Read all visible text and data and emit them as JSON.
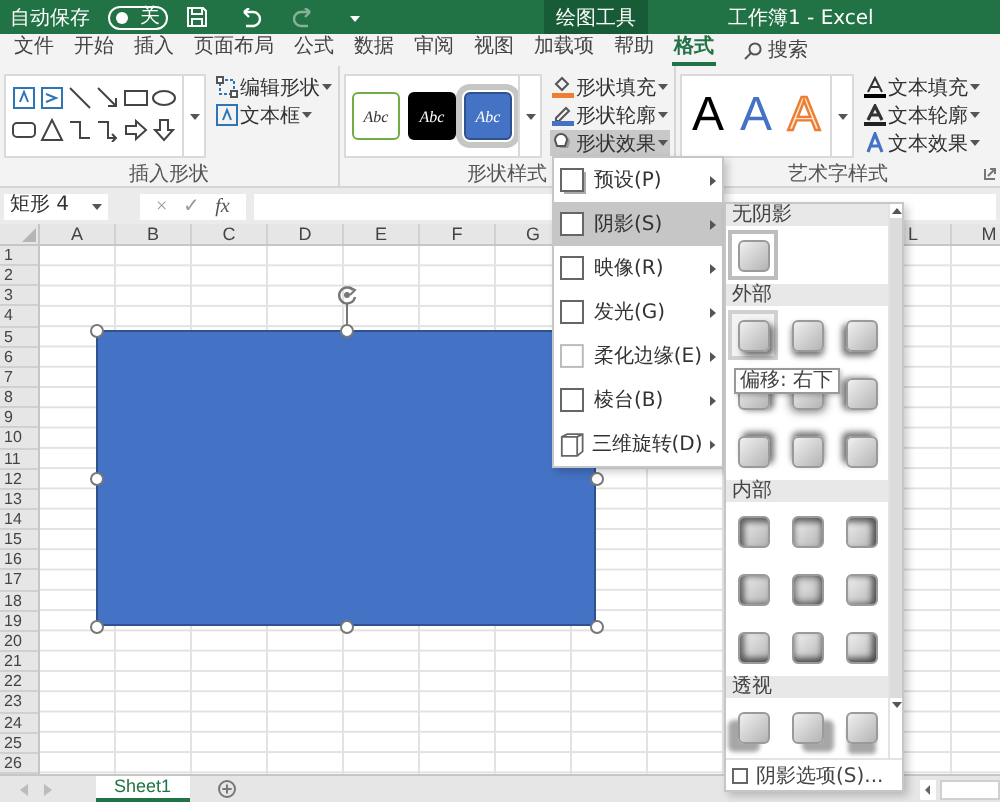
{
  "title_bar": {
    "autosave_label": "自动保存",
    "autosave": {
      "label": "关",
      "on": false
    },
    "context_tab": "绘图工具",
    "title": "工作簿1 - Excel"
  },
  "tabs": [
    {
      "label": "文件",
      "selected": false
    },
    {
      "label": "开始",
      "selected": false
    },
    {
      "label": "插入",
      "selected": false
    },
    {
      "label": "页面布局",
      "selected": false
    },
    {
      "label": "公式",
      "selected": false
    },
    {
      "label": "数据",
      "selected": false
    },
    {
      "label": "审阅",
      "selected": false
    },
    {
      "label": "视图",
      "selected": false
    },
    {
      "label": "加载项",
      "selected": false
    },
    {
      "label": "帮助",
      "selected": false
    },
    {
      "label": "格式",
      "selected": true
    }
  ],
  "search": {
    "placeholder": "搜索"
  },
  "ribbon": {
    "insert_shapes": {
      "title": "插入形状",
      "buttons": [
        "编辑形状",
        "文本框"
      ]
    },
    "shape_styles": {
      "title": "形状样式",
      "presets": [
        {
          "label": "Abc",
          "kind": "outline",
          "selected": false
        },
        {
          "label": "Abc",
          "kind": "dark",
          "selected": false
        },
        {
          "label": "Abc",
          "kind": "blue",
          "selected": true
        }
      ],
      "buttons": [
        {
          "label": "形状填充",
          "pressed": false
        },
        {
          "label": "形状轮廓",
          "pressed": false
        },
        {
          "label": "形状效果",
          "pressed": true
        }
      ]
    },
    "wordart_styles": {
      "title": "艺术字样式",
      "presets": [
        {
          "label": "A",
          "kind": "black"
        },
        {
          "label": "A",
          "kind": "blue"
        },
        {
          "label": "A",
          "kind": "orange-outline"
        }
      ],
      "buttons": [
        "文本填充",
        "文本轮廓",
        "文本效果"
      ]
    }
  },
  "formula_bar": {
    "name_box": "矩形 4",
    "buttons": [
      "×",
      "✓",
      "fx"
    ]
  },
  "sheet": {
    "columns_left": [
      "A",
      "B",
      "C",
      "D",
      "E",
      "F",
      "G"
    ],
    "columns_right": [
      "L",
      "M"
    ],
    "rows": [
      "1",
      "2",
      "3",
      "4",
      "5",
      "6",
      "7",
      "8",
      "9",
      "10",
      "11",
      "12",
      "13",
      "14",
      "15",
      "16",
      "17",
      "18",
      "19",
      "20",
      "21",
      "22",
      "23",
      "24",
      "25",
      "26"
    ]
  },
  "sheet_tabs": [
    {
      "label": "Sheet1",
      "selected": true
    }
  ],
  "effects_menu": [
    {
      "label": "预设(P)",
      "selected": false
    },
    {
      "label": "阴影(S)",
      "selected": true
    },
    {
      "label": "映像(R)",
      "selected": false
    },
    {
      "label": "发光(G)",
      "selected": false
    },
    {
      "label": "柔化边缘(E)",
      "selected": false
    },
    {
      "label": "棱台(B)",
      "selected": false
    },
    {
      "label": "三维旋转(D)",
      "selected": false
    }
  ],
  "shadow_gallery": {
    "sections": [
      {
        "title": "无阴影",
        "kind": "none",
        "items": [
          {
            "selected": true,
            "hovered": false
          }
        ]
      },
      {
        "title": "外部",
        "kind": "outer",
        "items": [
          {
            "selected": false,
            "hovered": true
          },
          {
            "selected": false,
            "hovered": false
          },
          {
            "selected": false,
            "hovered": false
          },
          {
            "selected": false,
            "hovered": false
          },
          {
            "selected": false,
            "hovered": false
          },
          {
            "selected": false,
            "hovered": false
          },
          {
            "selected": false,
            "hovered": false
          },
          {
            "selected": false,
            "hovered": false
          },
          {
            "selected": false,
            "hovered": false
          }
        ]
      },
      {
        "title": "内部",
        "kind": "inner",
        "items": [
          {
            "selected": false,
            "hovered": false
          },
          {
            "selected": false,
            "hovered": false
          },
          {
            "selected": false,
            "hovered": false
          },
          {
            "selected": false,
            "hovered": false
          },
          {
            "selected": false,
            "hovered": false
          },
          {
            "selected": false,
            "hovered": false
          },
          {
            "selected": false,
            "hovered": false
          },
          {
            "selected": false,
            "hovered": false
          },
          {
            "selected": false,
            "hovered": false
          }
        ]
      },
      {
        "title": "透视",
        "kind": "perspective",
        "items": [
          {
            "selected": false,
            "hovered": false
          },
          {
            "selected": false,
            "hovered": false
          },
          {
            "selected": false,
            "hovered": false
          }
        ]
      }
    ],
    "tooltip": "偏移: 右下",
    "options": "阴影选项(S)..."
  }
}
